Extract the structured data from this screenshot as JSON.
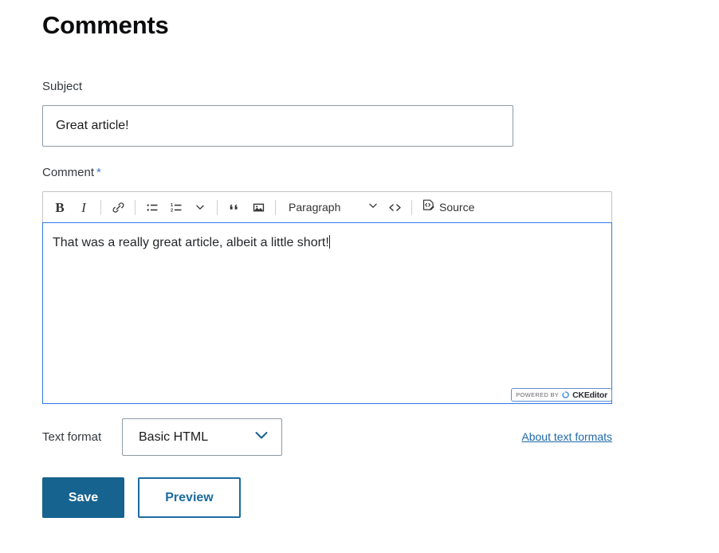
{
  "page": {
    "title": "Comments"
  },
  "subject": {
    "label": "Subject",
    "value": "Great article!",
    "placeholder": ""
  },
  "comment": {
    "label": "Comment",
    "required_marker": "*",
    "required_color": "#3b7cc4",
    "body_text": "That was a really great article, albeit a little short!"
  },
  "toolbar": {
    "bold_label": "B",
    "italic_label": "I",
    "link_name": "link-icon",
    "bulleted_list_name": "bulleted-list-icon",
    "numbered_list_name": "numbered-list-icon",
    "list_dropdown_name": "chevron-down-icon",
    "blockquote_label": "“",
    "image_name": "image-icon",
    "paragraph_label": "Paragraph",
    "paragraph_chevron_name": "chevron-down-icon",
    "code_label": "<>",
    "source_label": "Source",
    "source_icon_name": "source-editing-icon"
  },
  "badge": {
    "powered_by": "POWERED BY",
    "brand": "CKEditor"
  },
  "text_format": {
    "label": "Text format",
    "selected": "Basic HTML",
    "options": [
      "Basic HTML"
    ],
    "about_link": "About text formats"
  },
  "actions": {
    "save_label": "Save",
    "preview_label": "Preview"
  },
  "colors": {
    "primary": "#16638f",
    "secondary_border": "#1c6ca1",
    "focus_border": "#2f7ae5",
    "link": "#2169a8",
    "field_border": "#8d9aa5",
    "toolbar_border": "#c4c4c4"
  }
}
